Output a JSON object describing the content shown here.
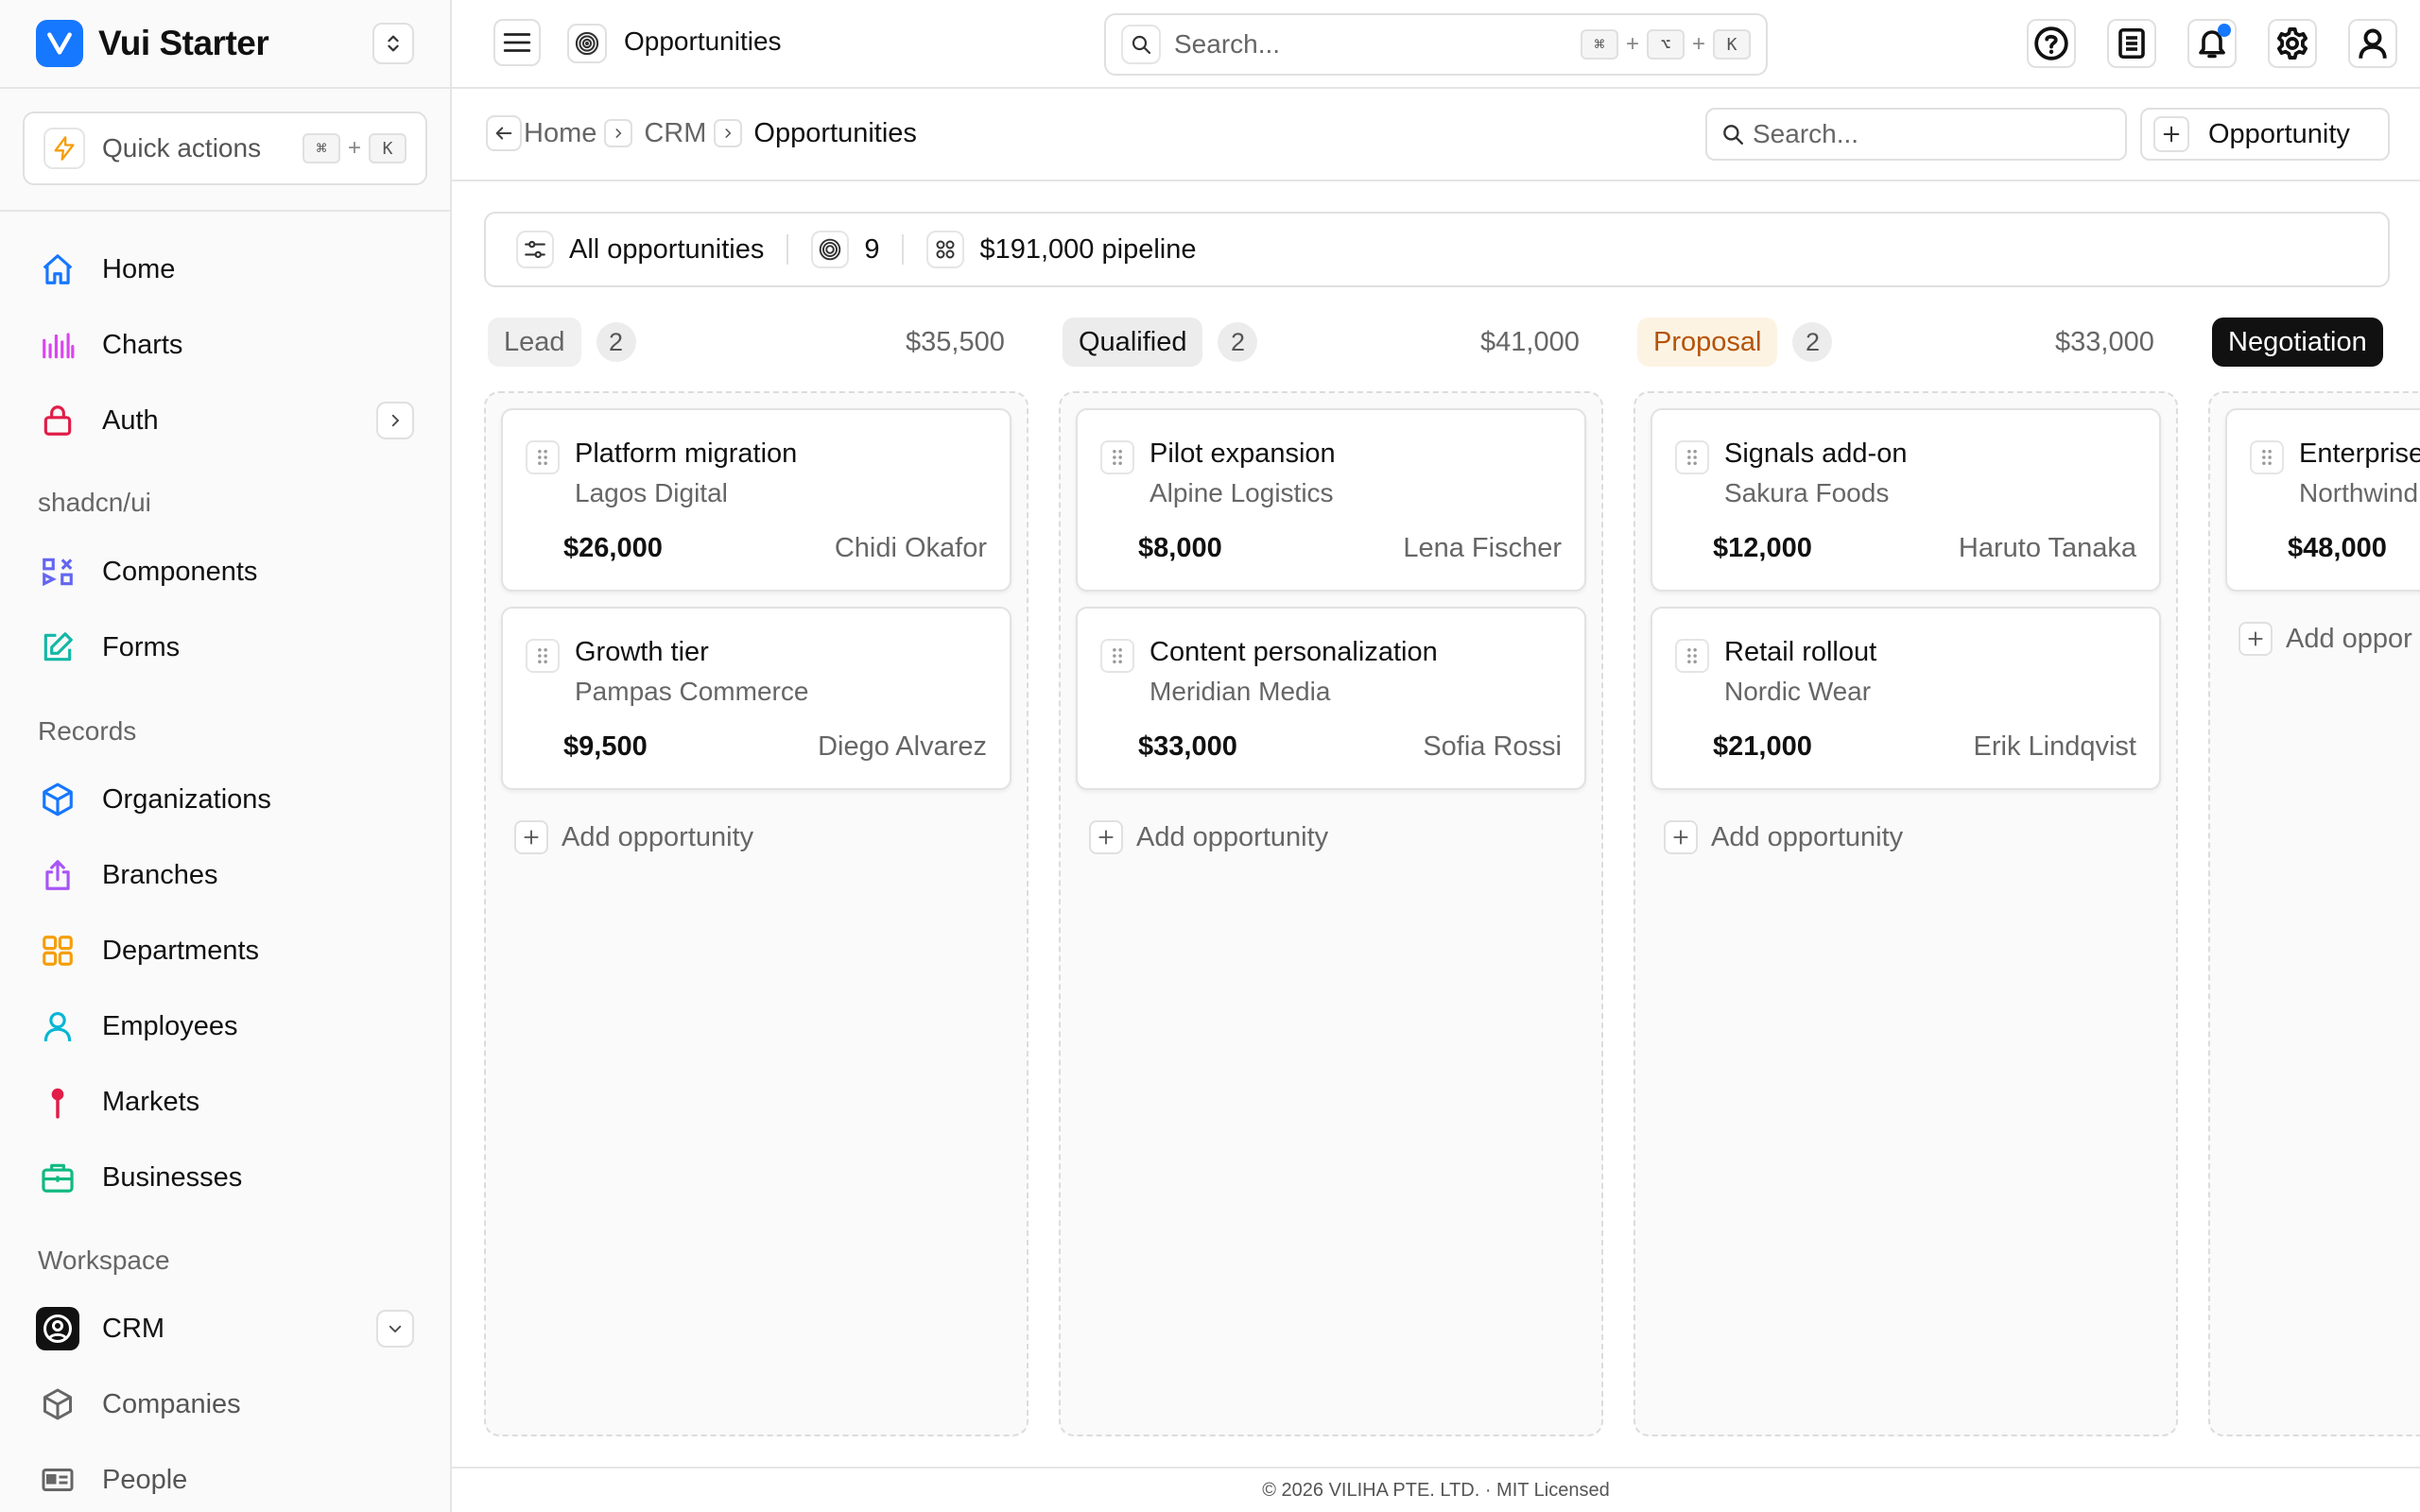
{
  "brand": {
    "name": "Vui Starter",
    "accent": "#1677ff"
  },
  "quick_actions": {
    "label": "Quick actions",
    "keys": [
      "⌘",
      "K"
    ]
  },
  "sidebar": {
    "main": [
      {
        "label": "Home",
        "icon": "home-icon",
        "color": "#1677ff"
      },
      {
        "label": "Charts",
        "icon": "bar-chart-icon",
        "color": "#d946ef"
      },
      {
        "label": "Auth",
        "icon": "lock-icon",
        "color": "#e11d48"
      }
    ],
    "shadcn_label": "shadcn/ui",
    "shadcn": [
      {
        "label": "Components",
        "icon": "components-icon",
        "color": "#6366f1"
      },
      {
        "label": "Forms",
        "icon": "edit-icon",
        "color": "#14b8a6"
      }
    ],
    "records_label": "Records",
    "records": [
      {
        "label": "Organizations",
        "icon": "box-icon",
        "color": "#1677ff"
      },
      {
        "label": "Branches",
        "icon": "share-icon",
        "color": "#a855f7"
      },
      {
        "label": "Departments",
        "icon": "grid-icon",
        "color": "#f59e0b"
      },
      {
        "label": "Employees",
        "icon": "user-icon",
        "color": "#06b6d4"
      },
      {
        "label": "Markets",
        "icon": "pin-icon",
        "color": "#e11d48"
      },
      {
        "label": "Businesses",
        "icon": "briefcase-icon",
        "color": "#10b981"
      }
    ],
    "workspace_label": "Workspace",
    "workspace": [
      {
        "label": "CRM",
        "icon": "crm-icon"
      },
      {
        "label": "Companies",
        "icon": "package-icon"
      },
      {
        "label": "People",
        "icon": "id-card-icon"
      }
    ]
  },
  "topbar": {
    "page_title": "Opportunities",
    "search_placeholder": "Search...",
    "search_keys": [
      "⌘",
      "⌥",
      "K"
    ]
  },
  "breadcrumb": {
    "items": [
      "Home",
      "CRM",
      "Opportunities"
    ],
    "search_placeholder": "Search...",
    "add_button": "Opportunity"
  },
  "summary": {
    "filter": "All opportunities",
    "count": "9",
    "pipeline": "$191,000 pipeline"
  },
  "columns": [
    {
      "stage": "Lead",
      "count": "2",
      "total": "$35,500",
      "pill_bg": "#f0f0f0",
      "pill_fg": "#666666",
      "cards": [
        {
          "title": "Platform migration",
          "company": "Lagos Digital",
          "amount": "$26,000",
          "owner": "Chidi Okafor"
        },
        {
          "title": "Growth tier",
          "company": "Pampas Commerce",
          "amount": "$9,500",
          "owner": "Diego Alvarez"
        }
      ],
      "add_label": "Add opportunity"
    },
    {
      "stage": "Qualified",
      "count": "2",
      "total": "$41,000",
      "pill_bg": "#ececec",
      "pill_fg": "#111111",
      "cards": [
        {
          "title": "Pilot expansion",
          "company": "Alpine Logistics",
          "amount": "$8,000",
          "owner": "Lena Fischer"
        },
        {
          "title": "Content personalization",
          "company": "Meridian Media",
          "amount": "$33,000",
          "owner": "Sofia Rossi"
        }
      ],
      "add_label": "Add opportunity"
    },
    {
      "stage": "Proposal",
      "count": "2",
      "total": "$33,000",
      "pill_bg": "#fdf3e3",
      "pill_fg": "#b45309",
      "cards": [
        {
          "title": "Signals add-on",
          "company": "Sakura Foods",
          "amount": "$12,000",
          "owner": "Haruto Tanaka"
        },
        {
          "title": "Retail rollout",
          "company": "Nordic Wear",
          "amount": "$21,000",
          "owner": "Erik Lindqvist"
        }
      ],
      "add_label": "Add opportunity"
    },
    {
      "stage": "Negotiation",
      "count": "",
      "total": "",
      "pill_bg": "#111111",
      "pill_fg": "#ffffff",
      "cards": [
        {
          "title": "Enterprise",
          "company": "Northwind",
          "amount": "$48,000",
          "owner": ""
        }
      ],
      "add_label": "Add oppor"
    }
  ],
  "footer": "© 2026 VILIHA PTE. LTD. · MIT Licensed"
}
